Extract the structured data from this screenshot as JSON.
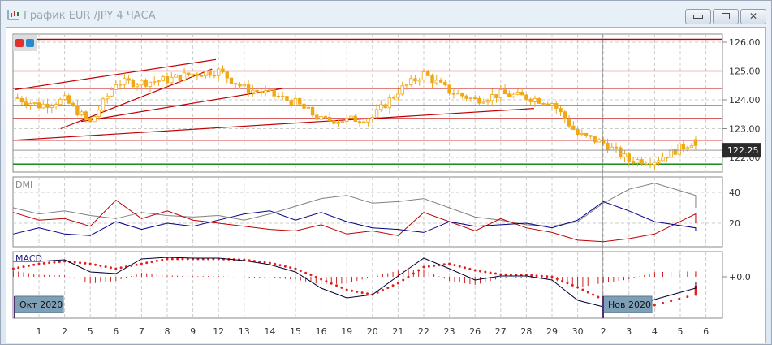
{
  "window": {
    "title": "График EUR /JPY  4 ЧАСА",
    "buttons": [
      "minimize",
      "restore",
      "close"
    ]
  },
  "colors": {
    "candle": "#f0a818",
    "hline": "#c00000",
    "support": "#008000",
    "adx": "#808080",
    "plus_di": "#00008b",
    "minus_di": "#c00000",
    "macd": "#000033",
    "signal": "#e02020",
    "price_tag_bg": "#2b2b2b"
  },
  "panels": {
    "dmi_label": "DMI",
    "macd_label": "MACD"
  },
  "month_labels": [
    "Окт 2020",
    "Нов 2020"
  ],
  "current_price": "122.25",
  "chart_data": [
    {
      "type": "candlestick",
      "x_ticks": [
        "1",
        "2",
        "5",
        "6",
        "7",
        "8",
        "9",
        "12",
        "13",
        "14",
        "15",
        "16",
        "19",
        "20",
        "21",
        "22",
        "23",
        "26",
        "27",
        "28",
        "29",
        "30",
        "2",
        "3",
        "4",
        "5",
        "6"
      ],
      "y_ticks": [
        "126.00",
        "125.00",
        "124.00",
        "123.00",
        "122.00"
      ],
      "ylim": [
        121.6,
        126.2
      ],
      "close_by_day": [
        124.1,
        123.8,
        124.0,
        123.2,
        124.6,
        124.6,
        124.7,
        124.9,
        125.0,
        124.4,
        124.2,
        123.9,
        123.3,
        123.3,
        123.4,
        124.3,
        124.9,
        124.3,
        124.0,
        124.2,
        124.1,
        123.9,
        122.8,
        122.5,
        121.9,
        121.9,
        122.6,
        122.3
      ],
      "horizontal_levels": [
        126.1,
        125.0,
        124.4,
        123.8,
        123.35,
        122.6
      ],
      "support_level": 121.77,
      "trend_lines": [
        {
          "from": [
            -0.95,
            124.35
          ],
          "to": [
            6.9,
            125.4
          ]
        },
        {
          "from": [
            0.85,
            123.0
          ],
          "to": [
            6.75,
            125.07
          ]
        },
        {
          "from": [
            1.65,
            123.25
          ],
          "to": [
            9.55,
            124.4
          ]
        },
        {
          "from": [
            -0.95,
            122.6
          ],
          "to": [
            19.3,
            123.7
          ]
        }
      ]
    },
    {
      "type": "line",
      "name": "DMI",
      "y_ticks": [
        "40",
        "20"
      ],
      "ylim": [
        8,
        50
      ],
      "series": [
        {
          "key": "adx",
          "values": [
            30,
            26,
            28,
            25,
            23,
            27,
            25,
            24,
            25,
            22,
            26,
            31,
            36,
            38,
            33,
            34,
            36,
            30,
            24,
            22,
            19,
            18,
            21,
            33,
            42,
            46,
            38,
            30
          ]
        },
        {
          "key": "minus_di",
          "values": [
            27,
            22,
            23,
            18,
            35,
            23,
            28,
            22,
            20,
            18,
            16,
            15,
            19,
            13,
            15,
            12,
            27,
            21,
            15,
            23,
            17,
            14,
            9,
            8,
            10,
            13,
            26,
            20
          ]
        },
        {
          "key": "plus_di",
          "values": [
            13,
            17,
            13,
            12,
            21,
            16,
            20,
            18,
            22,
            26,
            28,
            22,
            27,
            21,
            17,
            16,
            14,
            21,
            18,
            19,
            20,
            17,
            22,
            34,
            28,
            21,
            17,
            15
          ]
        }
      ]
    },
    {
      "type": "line",
      "name": "MACD",
      "y_ticks": [
        "+0.0"
      ],
      "series": [
        {
          "key": "macd",
          "values": [
            1.9,
            1.9,
            2.1,
            0.6,
            0.4,
            2.2,
            2.4,
            2.3,
            2.3,
            2.0,
            1.5,
            0.6,
            -1.4,
            -2.6,
            -2.2,
            0.1,
            2.3,
            1.0,
            -0.4,
            0.1,
            0.1,
            -0.4,
            -2.9,
            -3.7,
            -4.2,
            -2.8,
            -1.4,
            -0.7
          ]
        },
        {
          "key": "signal",
          "values": [
            1.0,
            1.6,
            1.9,
            1.6,
            1.0,
            1.6,
            2.2,
            2.2,
            2.2,
            2.1,
            1.7,
            1.0,
            -0.3,
            -1.6,
            -2.2,
            -0.8,
            1.2,
            1.6,
            0.8,
            0.3,
            0.2,
            0.0,
            -1.3,
            -2.8,
            -3.8,
            -3.5,
            -2.2,
            -1.0
          ]
        }
      ]
    }
  ]
}
